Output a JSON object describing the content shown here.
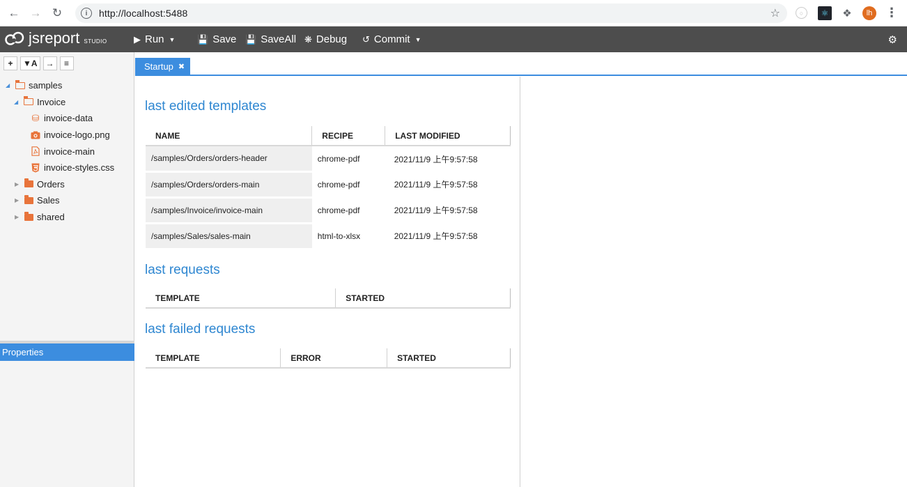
{
  "browser": {
    "url": "http://localhost:5488",
    "avatar_initials": "lh"
  },
  "toolbar": {
    "logo_text": "jsreport",
    "logo_sub": "STUDIO",
    "run_label": "Run",
    "save_label": "Save",
    "saveall_label": "SaveAll",
    "debug_label": "Debug",
    "commit_label": "Commit"
  },
  "tree_tools": [
    "+",
    "▼A",
    "→",
    "≡"
  ],
  "tree": {
    "items": [
      {
        "label": "samples",
        "type": "folder-open",
        "depth": 0
      },
      {
        "label": "Invoice",
        "type": "folder-open",
        "depth": 1
      },
      {
        "label": "invoice-data",
        "type": "data",
        "depth": 2
      },
      {
        "label": "invoice-logo.png",
        "type": "image",
        "depth": 2
      },
      {
        "label": "invoice-main",
        "type": "pdf",
        "depth": 2
      },
      {
        "label": "invoice-styles.css",
        "type": "css",
        "depth": 2
      },
      {
        "label": "Orders",
        "type": "folder",
        "depth": 1
      },
      {
        "label": "Sales",
        "type": "folder",
        "depth": 1
      },
      {
        "label": "shared",
        "type": "folder",
        "depth": 1
      }
    ]
  },
  "properties_label": "Properties",
  "tab": {
    "label": "Startup"
  },
  "sections": {
    "templates_title": "last edited templates",
    "requests_title": "last requests",
    "failed_title": "last failed requests"
  },
  "templates_table": {
    "headers": [
      "NAME",
      "RECIPE",
      "LAST MODIFIED"
    ],
    "rows": [
      {
        "name": "/samples/Orders/orders-header",
        "recipe": "chrome-pdf",
        "modified": "2021/11/9 上午9:57:58"
      },
      {
        "name": "/samples/Orders/orders-main",
        "recipe": "chrome-pdf",
        "modified": "2021/11/9 上午9:57:58"
      },
      {
        "name": "/samples/Invoice/invoice-main",
        "recipe": "chrome-pdf",
        "modified": "2021/11/9 上午9:57:58"
      },
      {
        "name": "/samples/Sales/sales-main",
        "recipe": "html-to-xlsx",
        "modified": "2021/11/9 上午9:57:58"
      }
    ]
  },
  "requests_table": {
    "headers": [
      "TEMPLATE",
      "STARTED"
    ]
  },
  "failed_table": {
    "headers": [
      "TEMPLATE",
      "ERROR",
      "STARTED"
    ]
  },
  "colors": {
    "accent": "#3c8ddf",
    "toolbar": "#4d4d4d",
    "folder": "#e8743b"
  }
}
